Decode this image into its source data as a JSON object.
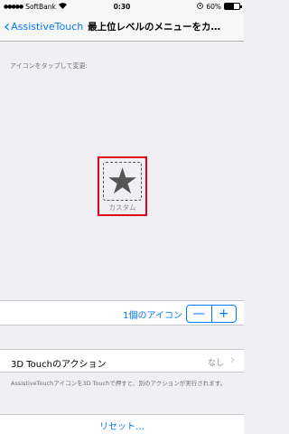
{
  "status_bar": {
    "signal": "●●●●●",
    "carrier": "SoftBank",
    "wifi": "wifi-icon",
    "time": "0:30",
    "battery_text": "60%",
    "battery_level": 0.6
  },
  "nav": {
    "back_label": "AssistiveTouch",
    "title": "最上位レベルのメニューをカ…"
  },
  "hint": "アイコンをタップして変更:",
  "icon": {
    "glyph": "★",
    "name": "star-icon",
    "label": "カスタム"
  },
  "count": {
    "label": "1個のアイコン",
    "minus": "—",
    "plus": "+"
  },
  "touch": {
    "label": "3D Touchのアクション",
    "value": "なし",
    "chevron": "›"
  },
  "footnote": "AssistiveTouchアイコンを3D Touchで押すと、別のアクションが実行されます。",
  "reset": "リセット…",
  "colors": {
    "accent": "#007aff",
    "highlight": "#e0001b",
    "background": "#efeff4"
  }
}
